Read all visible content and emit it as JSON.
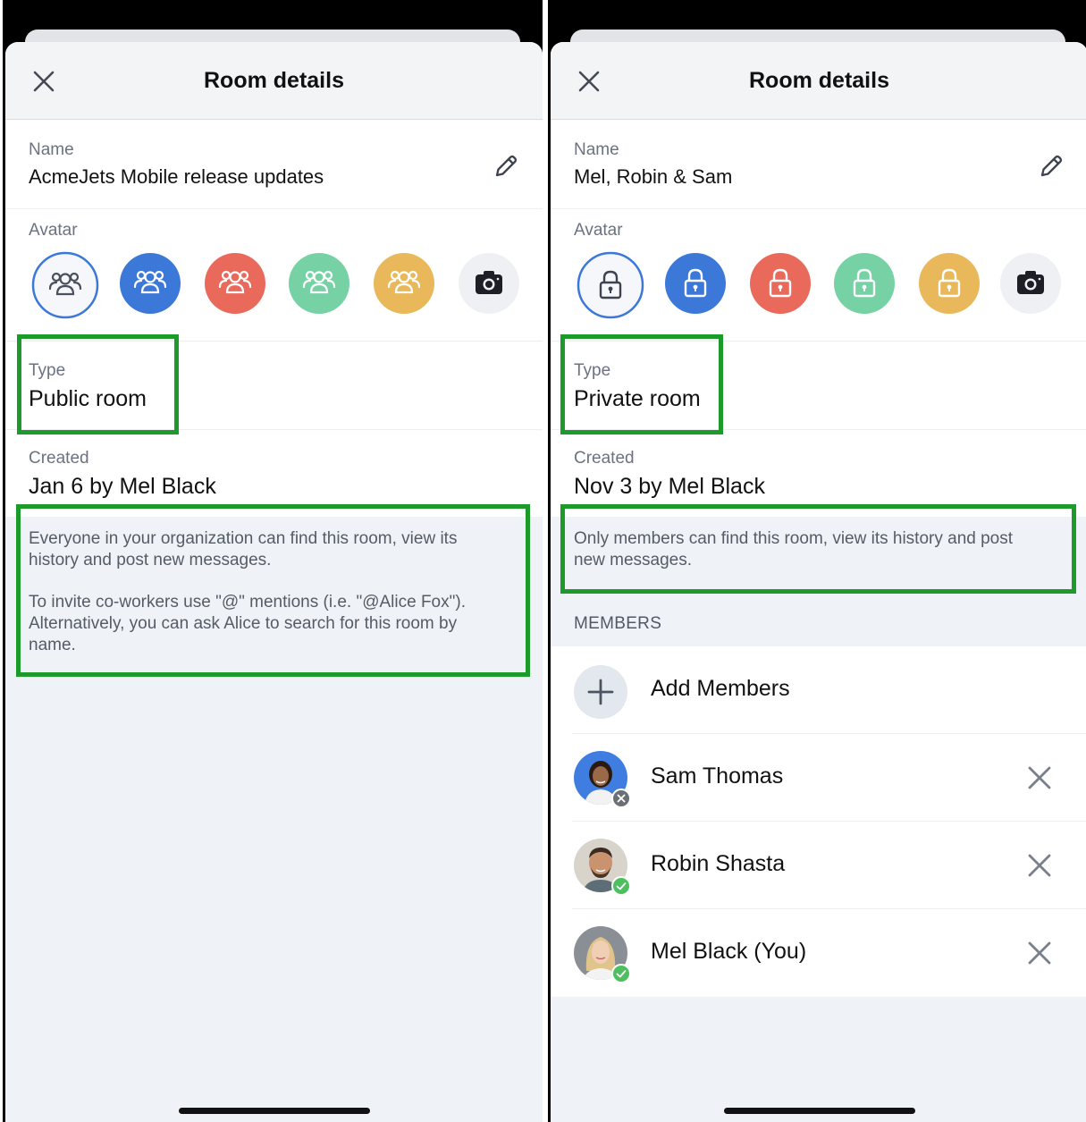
{
  "left": {
    "header": {
      "title": "Room details"
    },
    "name": {
      "label": "Name",
      "value": "AcmeJets Mobile release updates"
    },
    "avatar": {
      "label": "Avatar",
      "options": [
        "people-icon-white",
        "people-icon-blue",
        "people-icon-red",
        "people-icon-green",
        "people-icon-yellow",
        "camera-icon"
      ]
    },
    "type": {
      "label": "Type",
      "value": "Public room"
    },
    "created": {
      "label": "Created",
      "value": "Jan 6 by Mel Black"
    },
    "info": {
      "p1_l1": "Everyone in your organization can find this room, view its",
      "p1_l2": "history and post new messages.",
      "p2_l1": "To invite co-workers use \"@\" mentions (i.e. \"@Alice Fox\").",
      "p2_l2": "Alternatively, you can ask Alice to search for this room by",
      "p2_l3": "name."
    }
  },
  "right": {
    "header": {
      "title": "Room details"
    },
    "name": {
      "label": "Name",
      "value": "Mel, Robin & Sam"
    },
    "avatar": {
      "label": "Avatar",
      "options": [
        "lock-icon-white",
        "lock-icon-blue",
        "lock-icon-red",
        "lock-icon-green",
        "lock-icon-yellow",
        "camera-icon"
      ]
    },
    "type": {
      "label": "Type",
      "value": "Private room"
    },
    "created": {
      "label": "Created",
      "value": "Nov 3 by Mel Black"
    },
    "info": {
      "p1_l1": "Only members can find this room, view its history and post",
      "p1_l2": "new messages."
    },
    "members": {
      "header": "MEMBERS",
      "add_label": "Add Members",
      "list": [
        {
          "name": "Sam Thomas",
          "status": "offline"
        },
        {
          "name": "Robin Shasta",
          "status": "online"
        },
        {
          "name": "Mel Black (You)",
          "status": "online"
        }
      ]
    }
  },
  "colors": {
    "accent_blue": "#3b78d8",
    "red": "#e9695b",
    "green": "#76d2a4",
    "yellow": "#e9b85a",
    "highlight_green": "#1c9a2a",
    "online": "#4cc05f",
    "offline": "#6b6f76"
  }
}
